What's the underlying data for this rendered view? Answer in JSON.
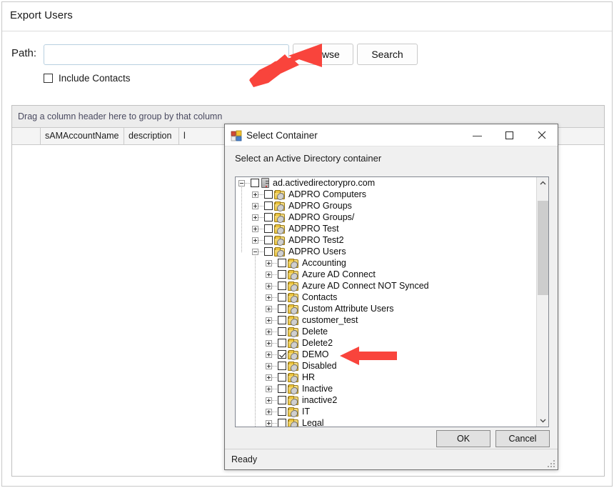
{
  "app": {
    "title": "Export Users",
    "path_label": "Path:",
    "path_value": "",
    "path_placeholder": "",
    "browse_label": "Browse",
    "search_label": "Search",
    "include_contacts_label": "Include Contacts",
    "include_contacts_checked": false
  },
  "grid": {
    "group_hint": "Drag a column header here to group by that column",
    "columns": [
      "",
      "sAMAccountName",
      "description",
      "l"
    ],
    "rows": []
  },
  "dialog": {
    "title": "Select Container",
    "icon": "window-app-icon",
    "instruction": "Select an Active Directory container",
    "minimize_glyph": "—",
    "maximize_glyph": "☐",
    "close_glyph": "✕",
    "ok_label": "OK",
    "cancel_label": "Cancel",
    "status_text": "Ready",
    "scrollbar": {
      "up_glyph": "⌃",
      "down_glyph": "⌄",
      "thumb_top_pct": 5,
      "thumb_height_pct": 42
    },
    "tree": [
      {
        "label": "ad.activedirectorypro.com",
        "depth": 0,
        "icon": "server-icon",
        "expander": "minus",
        "checked": false
      },
      {
        "label": "ADPRO Computers",
        "depth": 1,
        "icon": "ou-folder-icon",
        "expander": "plus",
        "checked": false
      },
      {
        "label": "ADPRO Groups",
        "depth": 1,
        "icon": "ou-folder-icon",
        "expander": "plus",
        "checked": false
      },
      {
        "label": "ADPRO Groups/",
        "depth": 1,
        "icon": "ou-folder-icon",
        "expander": "plus",
        "checked": false
      },
      {
        "label": "ADPRO Test",
        "depth": 1,
        "icon": "ou-folder-icon",
        "expander": "plus",
        "checked": false
      },
      {
        "label": "ADPRO Test2",
        "depth": 1,
        "icon": "ou-folder-icon",
        "expander": "plus",
        "checked": false
      },
      {
        "label": "ADPRO Users",
        "depth": 1,
        "icon": "ou-folder-icon",
        "expander": "minus",
        "checked": false
      },
      {
        "label": "Accounting",
        "depth": 2,
        "icon": "ou-folder-icon",
        "expander": "plus",
        "checked": false
      },
      {
        "label": "Azure AD Connect",
        "depth": 2,
        "icon": "ou-folder-icon",
        "expander": "plus",
        "checked": false
      },
      {
        "label": "Azure AD Connect NOT Synced",
        "depth": 2,
        "icon": "ou-folder-icon",
        "expander": "plus",
        "checked": false
      },
      {
        "label": "Contacts",
        "depth": 2,
        "icon": "ou-folder-icon",
        "expander": "plus",
        "checked": false
      },
      {
        "label": "Custom Attribute Users",
        "depth": 2,
        "icon": "ou-folder-icon",
        "expander": "plus",
        "checked": false
      },
      {
        "label": "customer_test",
        "depth": 2,
        "icon": "ou-folder-icon",
        "expander": "plus",
        "checked": false
      },
      {
        "label": "Delete",
        "depth": 2,
        "icon": "ou-folder-icon",
        "expander": "plus",
        "checked": false
      },
      {
        "label": "Delete2",
        "depth": 2,
        "icon": "ou-folder-icon",
        "expander": "plus",
        "checked": false
      },
      {
        "label": "DEMO",
        "depth": 2,
        "icon": "ou-folder-icon",
        "expander": "plus",
        "checked": true
      },
      {
        "label": "Disabled",
        "depth": 2,
        "icon": "ou-folder-icon",
        "expander": "plus",
        "checked": false
      },
      {
        "label": "HR",
        "depth": 2,
        "icon": "ou-folder-icon",
        "expander": "plus",
        "checked": false
      },
      {
        "label": "Inactive",
        "depth": 2,
        "icon": "ou-folder-icon",
        "expander": "plus",
        "checked": false
      },
      {
        "label": "inactive2",
        "depth": 2,
        "icon": "ou-folder-icon",
        "expander": "plus",
        "checked": false
      },
      {
        "label": "IT",
        "depth": 2,
        "icon": "ou-folder-icon",
        "expander": "plus",
        "checked": false
      },
      {
        "label": "Legal",
        "depth": 2,
        "icon": "ou-folder-icon",
        "expander": "plus",
        "checked": false
      }
    ]
  },
  "annotations": {
    "arrow_color": "#f9443c",
    "arrows": [
      {
        "name": "arrow-pointing-to-browse-button",
        "direction": "up-right"
      },
      {
        "name": "arrow-pointing-to-demo-node",
        "direction": "left"
      }
    ]
  }
}
